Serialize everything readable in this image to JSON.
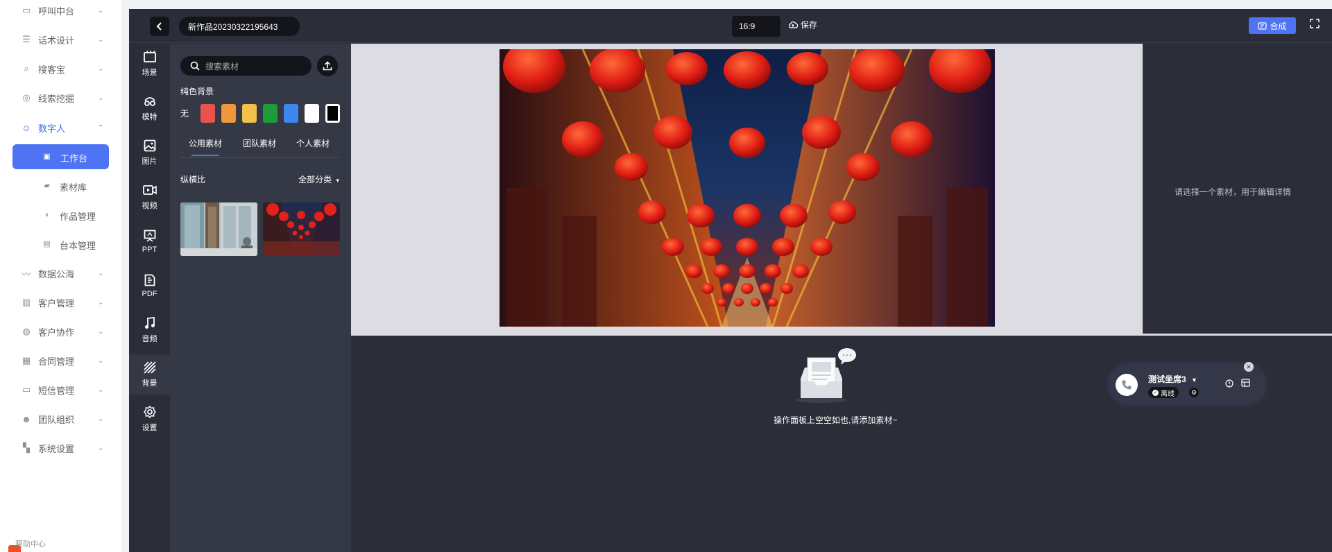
{
  "nav": {
    "items": [
      {
        "label": "呼叫中台",
        "icon": "monitor-icon"
      },
      {
        "label": "话术设计",
        "icon": "list-icon"
      },
      {
        "label": "搜客宝",
        "icon": "search-icon"
      },
      {
        "label": "线索挖掘",
        "icon": "target-icon"
      },
      {
        "label": "数字人",
        "icon": "robot-icon"
      },
      {
        "label": "数据公海",
        "icon": "chart-icon"
      },
      {
        "label": "客户管理",
        "icon": "contacts-icon"
      },
      {
        "label": "客户协作",
        "icon": "users-icon"
      },
      {
        "label": "合同管理",
        "icon": "clipboard-icon"
      },
      {
        "label": "短信管理",
        "icon": "message-icon"
      },
      {
        "label": "团队组织",
        "icon": "team-icon"
      },
      {
        "label": "系统设置",
        "icon": "grid-icon"
      }
    ],
    "sub_items": [
      {
        "label": "工作台",
        "icon": "workbench-icon"
      },
      {
        "label": "素材库",
        "icon": "folder-icon"
      },
      {
        "label": "作品管理",
        "icon": "tag-icon"
      },
      {
        "label": "台本管理",
        "icon": "document-icon"
      }
    ],
    "help_label": "帮助中心"
  },
  "editor": {
    "title": "新作品20230322195643",
    "ratio": "16:9",
    "save_label": "保存",
    "compose_label": "合成"
  },
  "rail": {
    "items": [
      {
        "label": "场景",
        "icon": "scene-icon"
      },
      {
        "label": "模特",
        "icon": "model-icon"
      },
      {
        "label": "图片",
        "icon": "image-icon"
      },
      {
        "label": "视频",
        "icon": "video-icon"
      },
      {
        "label": "PPT",
        "icon": "ppt-icon"
      },
      {
        "label": "PDF",
        "icon": "pdf-icon"
      },
      {
        "label": "音频",
        "icon": "music-icon"
      },
      {
        "label": "背景",
        "icon": "background-icon"
      },
      {
        "label": "设置",
        "icon": "gear-icon"
      }
    ]
  },
  "panel": {
    "search_placeholder": "搜索素材",
    "solid_bg_title": "纯色背景",
    "none_label": "无",
    "colors": [
      "#e8534e",
      "#f0973e",
      "#f2c04a",
      "#1f9c3a",
      "#3d87f0",
      "#ffffff",
      "#000000"
    ],
    "tabs": [
      "公用素材",
      "团队素材",
      "个人素材"
    ],
    "aspect_label": "纵横比",
    "category_label": "全部分类"
  },
  "props": {
    "hint": "请选择一个素材，用于编辑详情"
  },
  "timeline": {
    "empty_message": "操作面板上空空如也,请添加素材~"
  },
  "call_widget": {
    "agent_name": "测试坐席3",
    "status": "离线"
  }
}
